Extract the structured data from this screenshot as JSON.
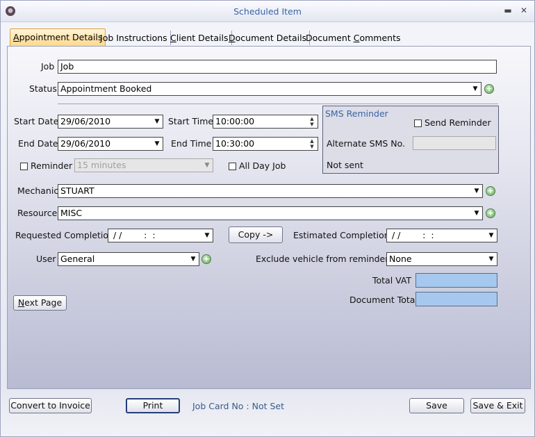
{
  "window": {
    "title": "Scheduled Item",
    "minimize": "▬",
    "close": "✕"
  },
  "tabs": [
    {
      "pre": "",
      "key": "A",
      "post": "ppointment Details"
    },
    {
      "pre": "",
      "key": "J",
      "post": "ob Instructions"
    },
    {
      "pre": "",
      "key": "C",
      "post": "lient Details"
    },
    {
      "pre": "",
      "key": "D",
      "post": "ocument Details"
    },
    {
      "pre": "Document ",
      "key": "C",
      "post": "omments"
    }
  ],
  "form": {
    "job_label": "Job",
    "job_value": "Job",
    "status_label": "Status",
    "status_value": "Appointment Booked",
    "start_date_label": "Start Date",
    "start_date_value": "29/06/2010",
    "start_time_label": "Start Time",
    "start_time_value": "10:00:00",
    "end_date_label": "End Date",
    "end_date_value": "29/06/2010",
    "end_time_label": "End Time",
    "end_time_value": "10:30:00",
    "reminder_label": "Reminder",
    "reminder_value": "15 minutes",
    "all_day_label": "All Day Job",
    "mechanic_label": "Mechanic",
    "mechanic_value": "STUART",
    "resource_label": "Resource",
    "resource_value": "MISC",
    "requested_label": "Requested Completion",
    "requested_value": " / /        :  :",
    "copy_label": "Copy ->",
    "estimated_label": "Estimated Completion",
    "estimated_value": " / /        :  :",
    "user_label": "User",
    "user_value": "General",
    "exclude_label": "Exclude vehicle from reminders",
    "exclude_value": "None",
    "total_vat_label": "Total VAT",
    "total_vat_value": "",
    "doc_total_label": "Document Total",
    "doc_total_value": "",
    "next_page_key": "N",
    "next_page_rest": "ext Page"
  },
  "sms": {
    "title": "SMS Reminder",
    "send_label": "Send Reminder",
    "alt_label": "Alternate SMS No.",
    "alt_value": "",
    "status": "Not sent"
  },
  "footer": {
    "convert_label": "Convert to Invoice",
    "print_label": "Print",
    "job_card": "Job Card No : Not Set",
    "save_label": "Save",
    "save_exit_label": "Save & Exit"
  }
}
